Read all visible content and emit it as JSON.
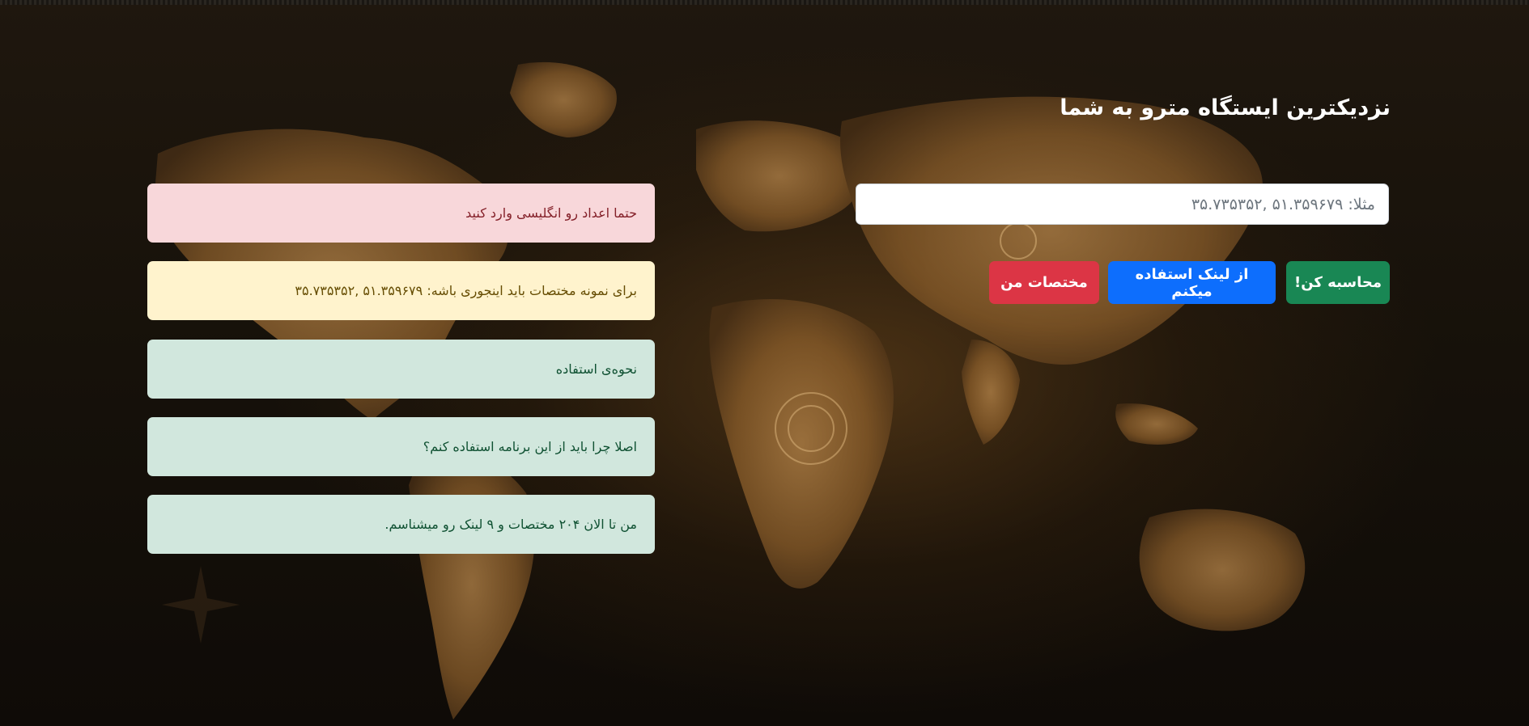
{
  "header": {
    "title": "نزدیکترین ایستگاه مترو به شما"
  },
  "search": {
    "placeholder": "مثلا: ۵۱.۳۵۹۶۷۹ ,۳۵.۷۳۵۳۵۲",
    "value": ""
  },
  "buttons": {
    "calculate": "محاسبه کن!",
    "use_link": "از لینک استفاده میکنم",
    "my_coords": "مختصات من"
  },
  "alerts": {
    "english_numbers": "حتما اعداد رو انگلیسی وارد کنید",
    "sample_format": "برای نمونه مختصات باید اینجوری باشه: ۵۱.۳۵۹۶۷۹ ,۳۵.۷۳۵۳۵۲",
    "how_to_use": "نحوه‌ی استفاده",
    "why_use": "اصلا چرا باید از این برنامه استفاده کنم؟",
    "stats": "من تا الان ۲۰۴ مختصات و ۹ لینک رو میشناسم."
  },
  "colors": {
    "success": "#198754",
    "primary": "#0d6efd",
    "danger": "#dc3545"
  },
  "icons": {
    "background": "world-map-background",
    "compass": "compass-rose-icon"
  }
}
